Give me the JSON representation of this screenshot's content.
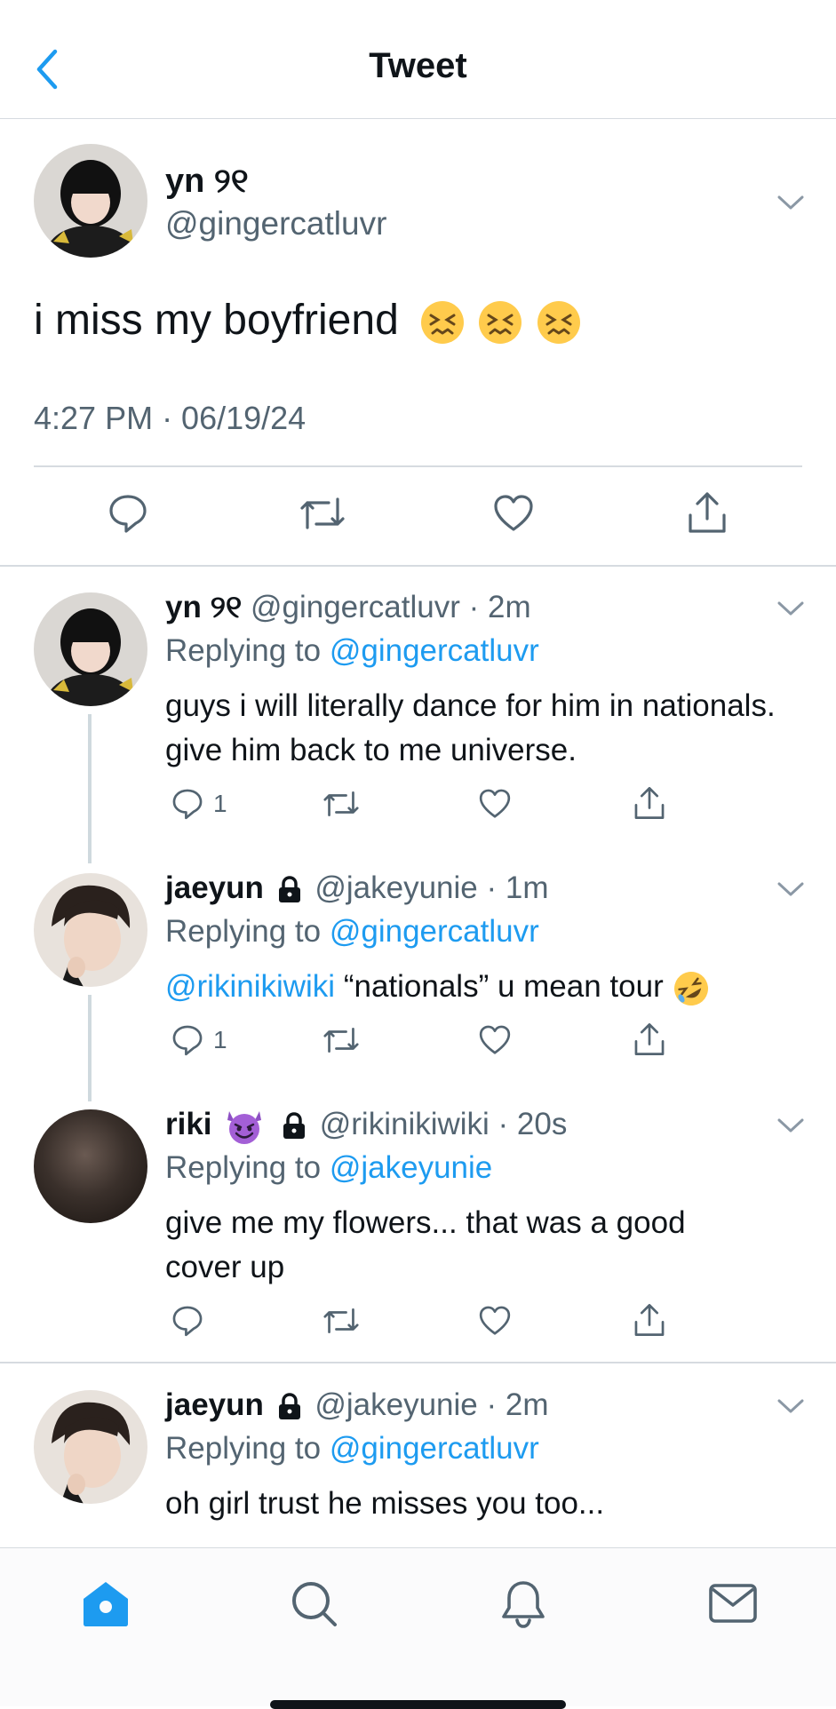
{
  "header": {
    "title": "Tweet"
  },
  "main_tweet": {
    "name": "yn ୨୧",
    "handle": "@gingercatluvr",
    "text": "i miss my boyfriend",
    "timestamp": "4:27 PM · 06/19/24"
  },
  "replies": [
    {
      "name": "yn ୨୧",
      "meta": "@gingercatluvr · 2m",
      "replying_prefix": "Replying to",
      "replying_to": "@gingercatluvr",
      "text": "guys i will literally dance for him in nationals. give him back to me universe.",
      "reply_count": "1"
    },
    {
      "name": "jaeyun",
      "meta": "@jakeyunie · 1m",
      "replying_prefix": "Replying to",
      "replying_to": "@gingercatluvr",
      "mention": "@rikinikiwiki",
      "text": "“nationals” u mean tour",
      "reply_count": "1"
    },
    {
      "name": "riki",
      "meta": "@rikinikiwiki · 20s",
      "replying_prefix": "Replying to",
      "replying_to": "@jakeyunie",
      "text": "give me my flowers... that was a good cover up"
    },
    {
      "name": "jaeyun",
      "meta": "@jakeyunie · 2m",
      "replying_prefix": "Replying to",
      "replying_to": "@gingercatluvr",
      "text": "oh girl trust he misses you too..."
    }
  ],
  "colors": {
    "accent": "#1d9bf0",
    "secondary_text": "#536471",
    "divider": "#d6dbe0"
  },
  "tabs": [
    "home-icon",
    "search-icon",
    "bell-icon",
    "mail-icon"
  ]
}
